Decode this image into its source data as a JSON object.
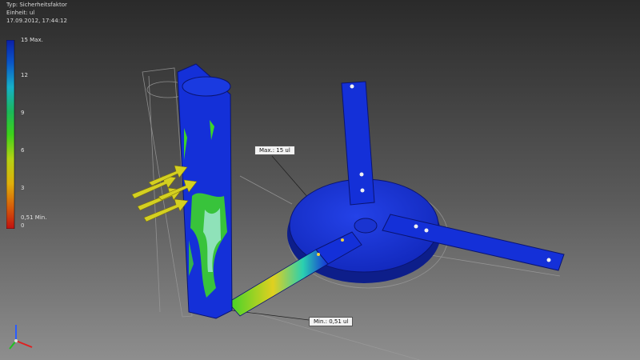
{
  "header": {
    "type_line": "Typ: Sicherheitsfaktor",
    "unit_line": "Einheit: ul",
    "date_line": "17.09.2012, 17:44:12"
  },
  "legend": {
    "max_label": "15 Max.",
    "tick_12": "12",
    "tick_9": "9",
    "tick_6": "6",
    "tick_3": "3",
    "min_label": "0,51 Min.",
    "tick_0": "0",
    "colors": [
      "#0b1fa8",
      "#0a56c8",
      "#16b0c8",
      "#1cb85a",
      "#3dd21a",
      "#b4d214",
      "#e0b00a",
      "#d8600a",
      "#c01010"
    ]
  },
  "callouts": {
    "max": "Max.: 15 ul",
    "min": "Min.: 0,51 ul"
  },
  "colors": {
    "safe_blue": "#1430d8",
    "highlight_green": "#3cd42a",
    "highlight_yellow": "#e0d020",
    "load_arrow": "#d4d020"
  },
  "icons": [
    "view-triad-icon",
    "load-arrow-icon"
  ]
}
